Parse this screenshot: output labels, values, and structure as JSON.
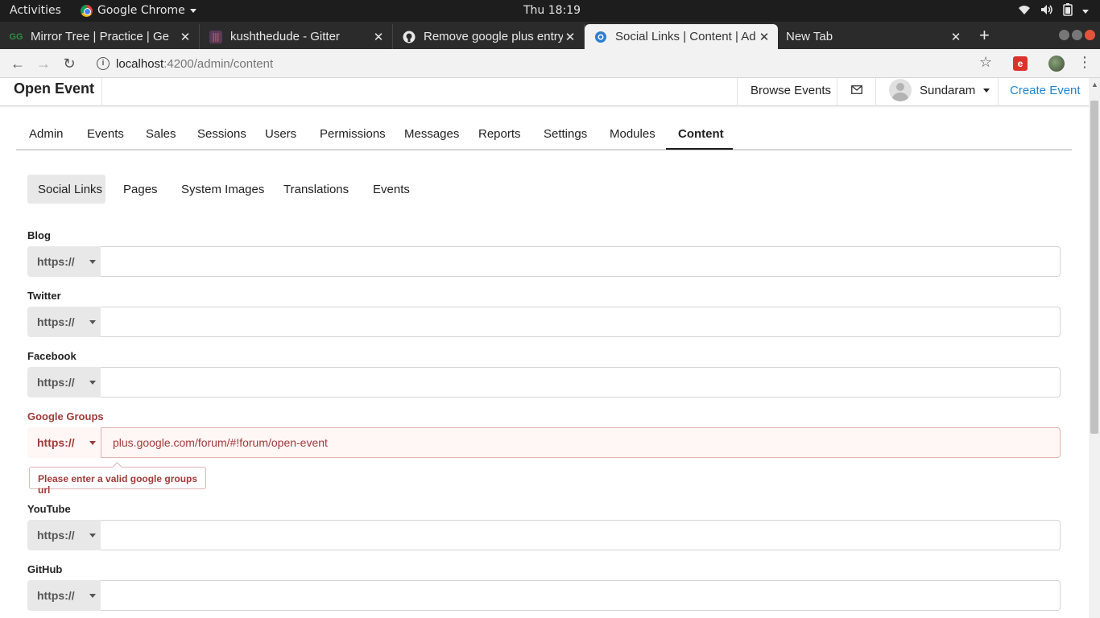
{
  "system_bar": {
    "activities": "Activities",
    "app_name": "Google Chrome",
    "clock": "Thu 18:19",
    "tray_icons": [
      "wifi-icon",
      "volume-icon",
      "battery-icon",
      "power-menu-icon"
    ]
  },
  "browser": {
    "tabs": [
      {
        "title": "Mirror Tree | Practice | Ge",
        "favicon": "gfg-icon",
        "active": false
      },
      {
        "title": "kushthedude - Gitter",
        "favicon": "gitter-icon",
        "active": false
      },
      {
        "title": "Remove google plus entry",
        "favicon": "github-icon",
        "active": false
      },
      {
        "title": "Social Links | Content | Ad",
        "favicon": "open-event-icon",
        "active": true
      },
      {
        "title": "New Tab",
        "favicon": "",
        "active": false
      }
    ],
    "url_host": "localhost",
    "url_path": ":4200/admin/content"
  },
  "app_header": {
    "brand": "Open Event",
    "browse_events": "Browse Events",
    "user_name": "Sundaram",
    "create_event": "Create Event"
  },
  "main_menu": [
    "Admin",
    "Events",
    "Sales",
    "Sessions",
    "Users",
    "Permissions",
    "Messages",
    "Reports",
    "Settings",
    "Modules",
    "Content"
  ],
  "main_menu_active": "Content",
  "sub_menu": [
    "Social Links",
    "Pages",
    "System Images",
    "Translations",
    "Events"
  ],
  "sub_menu_active": "Social Links",
  "form": {
    "protocol": "https://",
    "fields": [
      {
        "label": "Blog",
        "value": ""
      },
      {
        "label": "Twitter",
        "value": ""
      },
      {
        "label": "Facebook",
        "value": ""
      },
      {
        "label": "Google Groups",
        "value": "plus.google.com/forum/#!forum/open-event",
        "error": true
      },
      {
        "label": "YouTube",
        "value": ""
      },
      {
        "label": "GitHub",
        "value": ""
      }
    ],
    "error_message": "Please enter a valid google groups url"
  },
  "colors": {
    "error_text": "#9f3a38",
    "error_bg": "#fff6f6",
    "link_blue": "#2185d0"
  }
}
